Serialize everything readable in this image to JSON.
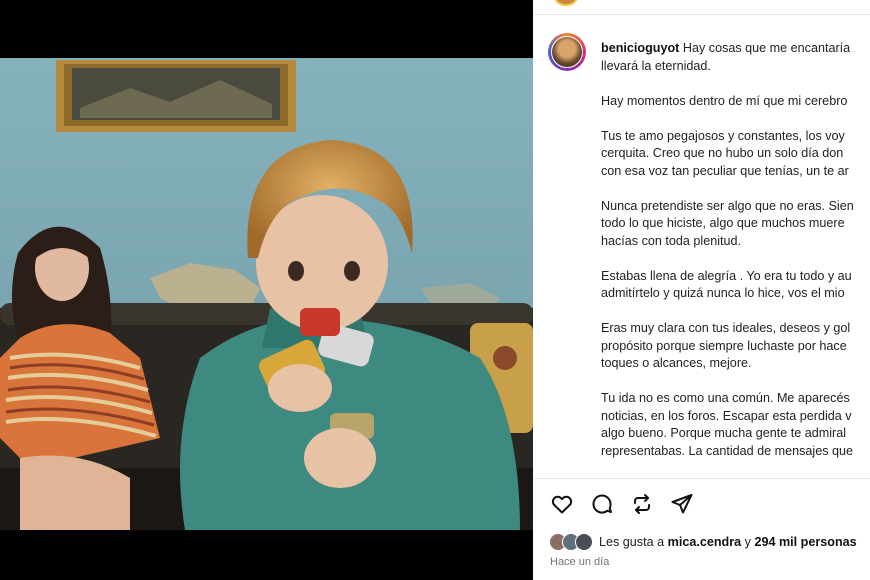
{
  "post": {
    "username": "benicioguyot",
    "caption_lines": [
      [
        "Hay cosas que me encantaría",
        "llevará la eternidad."
      ],
      [
        "Hay momentos dentro de mí que mi cerebro"
      ],
      [
        "Tus te amo pegajosos y constantes, los voy",
        "cerquita. Creo que no hubo un solo día don",
        "con esa voz tan peculiar que tenías, un te ar"
      ],
      [
        "Nunca pretendiste ser algo que no eras. Sien",
        "todo lo que hiciste, algo que muchos muere",
        "hacías con toda plenitud."
      ],
      [
        "Estabas llena de alegría . Yo era tu todo y au",
        "admitírtelo y quizá nunca lo hice, vos el mio"
      ],
      [
        "Eras muy clara con tus ideales, deseos y gol",
        "propósito porque siempre luchaste por hace",
        "toques o alcances, mejore."
      ],
      [
        "Tu ida no es como una común. Me aparecés",
        "noticias, en los foros. Escapar esta perdida v",
        "algo bueno. Porque mucha gente te admiral",
        "representabas. La cantidad de mensajes que"
      ]
    ],
    "likes_prefix": "Les gusta a",
    "liked_by_user": "mica.cendra",
    "likes_joiner": "y",
    "likes_count": "294 mil personas",
    "timestamp": "Hace un día"
  },
  "icons": {
    "like": "heart-outline-icon",
    "comment": "comment-bubble-icon",
    "repost": "repost-arrows-icon",
    "share": "send-paper-plane-icon"
  },
  "colors": {
    "text": "#222222",
    "secondary_text": "#737373",
    "wall": "#7aa7b3",
    "frame_gold": "#b48a3c"
  }
}
